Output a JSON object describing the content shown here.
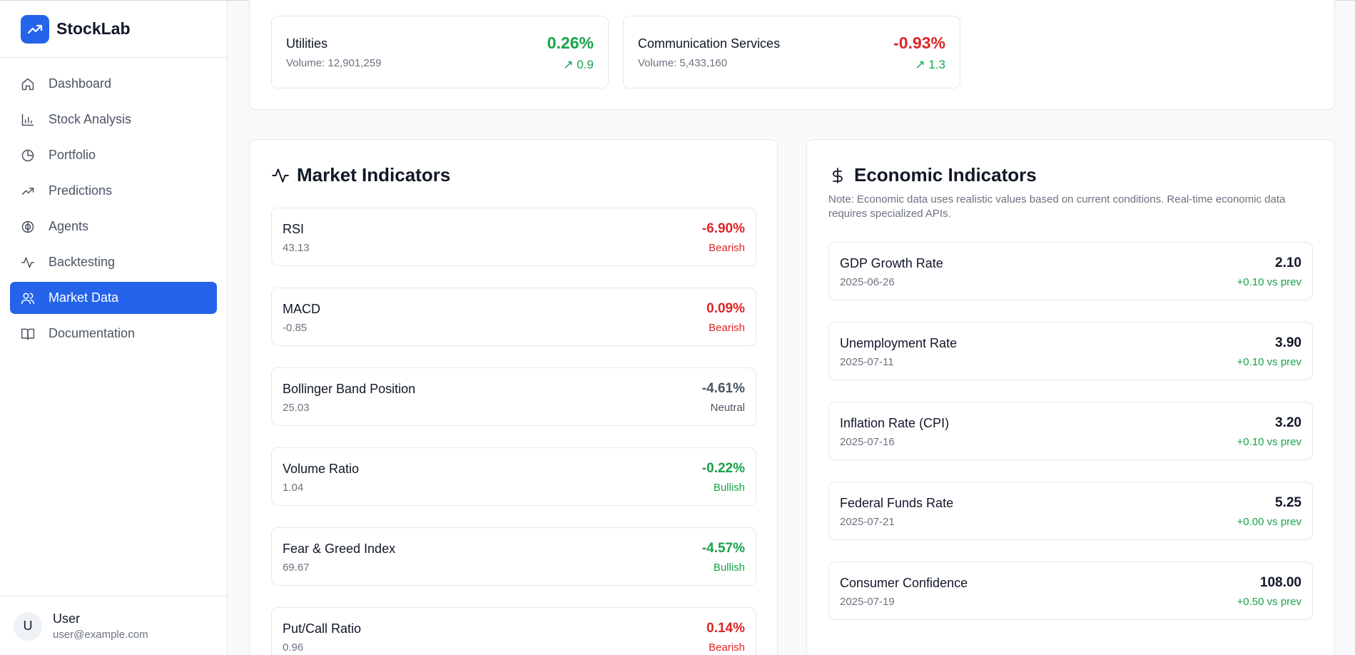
{
  "app": {
    "name": "StockLab"
  },
  "sidebar": {
    "items": [
      {
        "label": "Dashboard",
        "icon": "home-icon",
        "active": false
      },
      {
        "label": "Stock Analysis",
        "icon": "bar-chart-icon",
        "active": false
      },
      {
        "label": "Portfolio",
        "icon": "pie-chart-icon",
        "active": false
      },
      {
        "label": "Predictions",
        "icon": "trending-up-icon",
        "active": false
      },
      {
        "label": "Agents",
        "icon": "brain-icon",
        "active": false
      },
      {
        "label": "Backtesting",
        "icon": "activity-icon",
        "active": false
      },
      {
        "label": "Market Data",
        "icon": "users-icon",
        "active": true
      },
      {
        "label": "Documentation",
        "icon": "book-icon",
        "active": false
      }
    ]
  },
  "user": {
    "initial": "U",
    "name": "User",
    "email": "user@example.com"
  },
  "sectors": [
    {
      "name": "Utilities",
      "volume": "Volume: 12,901,259",
      "change_pct": "0.26%",
      "change": "↗ 0.9",
      "trend": "up"
    },
    {
      "name": "Communication Services",
      "volume": "Volume: 5,433,160",
      "change_pct": "-0.93%",
      "change": "↗ 1.3",
      "trend": "down"
    }
  ],
  "market_indicators": {
    "title": "Market Indicators",
    "items": [
      {
        "name": "RSI",
        "value": "43.13",
        "change": "-6.90%",
        "signal": "Bearish"
      },
      {
        "name": "MACD",
        "value": "-0.85",
        "change": "0.09%",
        "signal": "Bearish"
      },
      {
        "name": "Bollinger Band Position",
        "value": "25.03",
        "change": "-4.61%",
        "signal": "Neutral"
      },
      {
        "name": "Volume Ratio",
        "value": "1.04",
        "change": "-0.22%",
        "signal": "Bullish"
      },
      {
        "name": "Fear & Greed Index",
        "value": "69.67",
        "change": "-4.57%",
        "signal": "Bullish"
      },
      {
        "name": "Put/Call Ratio",
        "value": "0.96",
        "change": "0.14%",
        "signal": "Bearish"
      }
    ]
  },
  "economic_indicators": {
    "title": "Economic Indicators",
    "note": "Note: Economic data uses realistic values based on current conditions. Real-time economic data requires specialized APIs.",
    "items": [
      {
        "name": "GDP Growth Rate",
        "date": "2025-06-26",
        "value": "2.10",
        "delta": "+0.10 vs prev"
      },
      {
        "name": "Unemployment Rate",
        "date": "2025-07-11",
        "value": "3.90",
        "delta": "+0.10 vs prev"
      },
      {
        "name": "Inflation Rate (CPI)",
        "date": "2025-07-16",
        "value": "3.20",
        "delta": "+0.10 vs prev"
      },
      {
        "name": "Federal Funds Rate",
        "date": "2025-07-21",
        "value": "5.25",
        "delta": "+0.00 vs prev"
      },
      {
        "name": "Consumer Confidence",
        "date": "2025-07-19",
        "value": "108.00",
        "delta": "+0.50 vs prev"
      }
    ]
  },
  "colors": {
    "accent": "#2563eb",
    "bullish": "#16a34a",
    "bearish": "#dc2626",
    "neutral": "#4b5563"
  }
}
